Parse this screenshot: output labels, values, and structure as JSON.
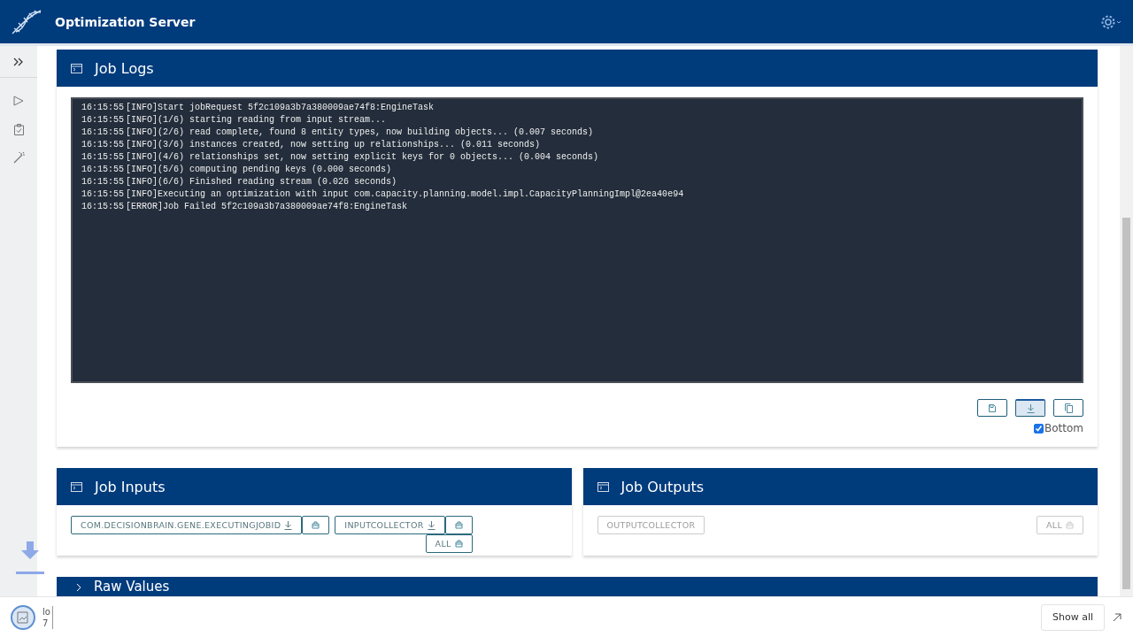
{
  "app": {
    "title": "Optimization Server"
  },
  "job_logs": {
    "title": "Job Logs",
    "lines": [
      {
        "time": "16:15:55",
        "level": "[INFO]",
        "message": "Start jobRequest 5f2c109a3b7a380009ae74f8:EngineTask"
      },
      {
        "time": "16:15:55",
        "level": "[INFO]",
        "message": "(1/6) starting reading from input stream..."
      },
      {
        "time": "16:15:55",
        "level": "[INFO]",
        "message": "(2/6) read complete, found 8 entity types, now building objects... (0.007 seconds)"
      },
      {
        "time": "16:15:55",
        "level": "[INFO]",
        "message": "(3/6) instances created, now setting up relationships... (0.011 seconds)"
      },
      {
        "time": "16:15:55",
        "level": "[INFO]",
        "message": "(4/6) relationships set, now setting explicit keys for 0 objects... (0.004 seconds)"
      },
      {
        "time": "16:15:55",
        "level": "[INFO]",
        "message": "(5/6) computing pending keys (0.000 seconds)"
      },
      {
        "time": "16:15:55",
        "level": "[INFO]",
        "message": "(6/6) Finished reading stream (0.026 seconds)"
      },
      {
        "time": "16:15:55",
        "level": "[INFO]",
        "message": "Executing an optimization with input com.capacity.planning.model.impl.CapacityPlanningImpl@2ea40e94"
      },
      {
        "time": "16:15:55",
        "level": "[ERROR]",
        "message": "Job Failed 5f2c109a3b7a380009ae74f8:EngineTask"
      }
    ],
    "actions": [
      {
        "kind": "save",
        "active": false
      },
      {
        "kind": "download",
        "active": true
      },
      {
        "kind": "copy",
        "active": false
      }
    ],
    "scroll_bottom": {
      "label": "Bottom",
      "checked": true
    }
  },
  "job_inputs": {
    "title": "Job Inputs",
    "items": [
      {
        "label": "COM.DECISIONBRAIN.GENE.EXECUTINGJOBID"
      },
      {
        "label": "INPUTCOLLECTOR"
      }
    ],
    "all": {
      "label": "ALL",
      "disabled": false
    }
  },
  "job_outputs": {
    "title": "Job Outputs",
    "items": [
      {
        "label": "OUTPUTCOLLECTOR",
        "disabled": true
      }
    ],
    "all": {
      "label": "ALL",
      "disabled": true
    }
  },
  "raw_values": {
    "title": "Raw Values"
  },
  "download_bar": {
    "file_name": "lo",
    "file_detail": "7",
    "show_all": "Show all"
  }
}
